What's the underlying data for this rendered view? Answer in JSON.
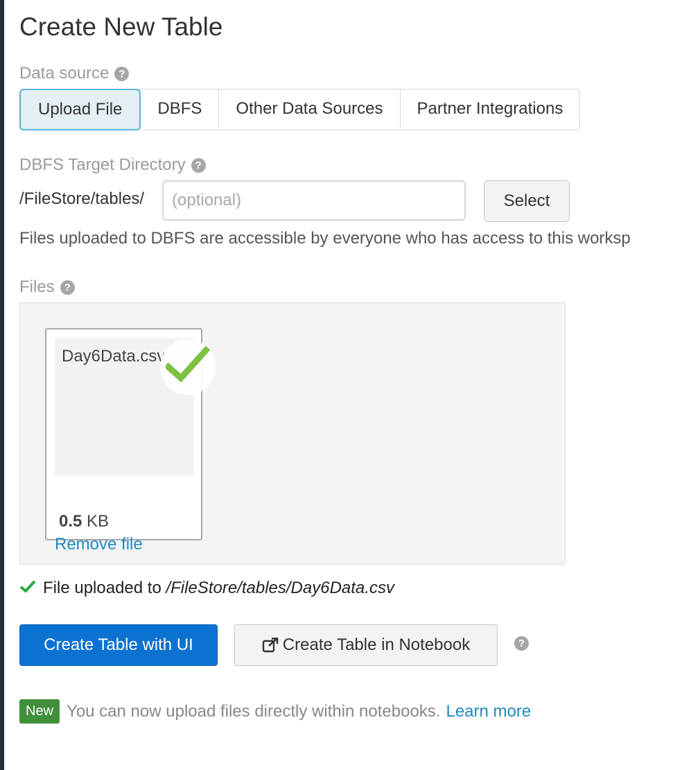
{
  "page": {
    "title": "Create New Table"
  },
  "data_source": {
    "label": "Data source",
    "tabs": [
      {
        "label": "Upload File",
        "active": true
      },
      {
        "label": "DBFS",
        "active": false
      },
      {
        "label": "Other Data Sources",
        "active": false
      },
      {
        "label": "Partner Integrations",
        "active": false
      }
    ]
  },
  "target_directory": {
    "label": "DBFS Target Directory",
    "path_prefix": "/FileStore/tables/",
    "input_value": "",
    "input_placeholder": "(optional)",
    "select_label": "Select",
    "access_note": "Files uploaded to DBFS are accessible by everyone who has access to this worksp"
  },
  "files": {
    "label": "Files",
    "items": [
      {
        "name": "Day6Data.csv",
        "size_value": "0.5",
        "size_unit": "KB",
        "remove_label": "Remove file",
        "status": "uploaded"
      }
    ]
  },
  "upload_status": {
    "prefix": "File uploaded to",
    "path": "/FileStore/tables/Day6Data.csv"
  },
  "actions": {
    "create_ui_label": "Create Table with UI",
    "create_notebook_label": "Create Table in Notebook"
  },
  "notice": {
    "badge": "New",
    "text": "You can now upload files directly within notebooks.",
    "link": "Learn more"
  },
  "icons": {
    "help": "question-circle-icon",
    "check": "check-icon",
    "external_link": "external-link-icon"
  },
  "colors": {
    "primary": "#0b72d2",
    "link": "#1f8ac0",
    "success_check": "#7cc142",
    "status_check": "#27a844",
    "new_badge": "#3f8f3b",
    "active_tab_border": "#5ab3d8",
    "rail": "#1e2d36"
  }
}
